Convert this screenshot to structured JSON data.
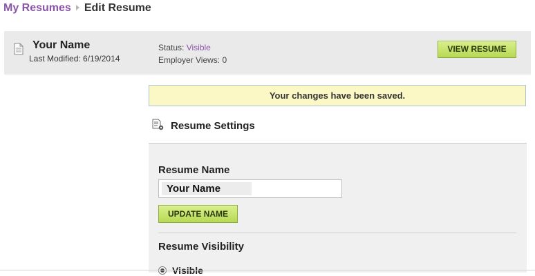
{
  "breadcrumb": {
    "parent": "My Resumes",
    "current": "Edit Resume"
  },
  "header": {
    "resume_name": "Your Name",
    "last_modified": "Last Modified: 6/19/2014",
    "status_label": "Status:",
    "status_value": "Visible",
    "employer_views": "Employer Views: 0",
    "view_button": "VIEW RESUME"
  },
  "notice": {
    "message": "Your changes have been saved."
  },
  "settings": {
    "title": "Resume Settings",
    "name_label": "Resume Name",
    "name_value": "Your Name",
    "update_button": "UPDATE NAME",
    "visibility_label": "Resume Visibility",
    "visibility_option": "Visible"
  },
  "colors": {
    "link": "#8a55a8",
    "button": "#c9e56f",
    "notice_bg": "#fcf8c5",
    "header_bg": "#eaeaea"
  },
  "icons": {
    "resume": "document-icon",
    "settings": "settings-document-icon"
  }
}
